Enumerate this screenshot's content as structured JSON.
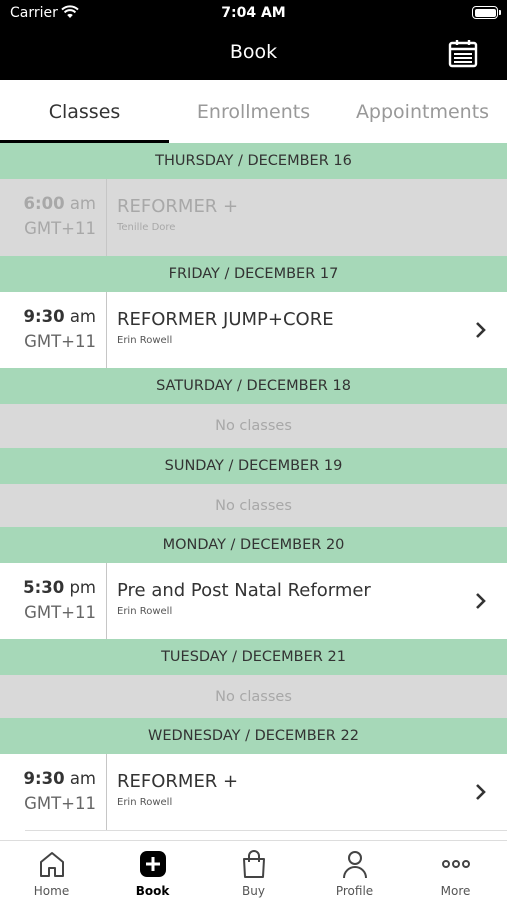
{
  "status_bar": {
    "carrier": "Carrier",
    "time": "7:04 AM"
  },
  "nav": {
    "title": "Book",
    "calendar_icon": "calendar-icon"
  },
  "tabs": [
    {
      "label": "Classes",
      "active": true
    },
    {
      "label": "Enrollments",
      "active": false
    },
    {
      "label": "Appointments",
      "active": false
    }
  ],
  "days": [
    {
      "header": "THURSDAY / DECEMBER 16",
      "class": {
        "time": "6:00",
        "ampm": "am",
        "tz": "GMT+11",
        "name": "REFORMER +",
        "teacher": "Tenille Dore",
        "disabled": true
      }
    },
    {
      "header": "FRIDAY / DECEMBER 17",
      "class": {
        "time": "9:30",
        "ampm": "am",
        "tz": "GMT+11",
        "name": "REFORMER JUMP+CORE",
        "teacher": "Erin Rowell",
        "disabled": false
      }
    },
    {
      "header": "SATURDAY / DECEMBER 18",
      "empty_text": "No classes"
    },
    {
      "header": "SUNDAY / DECEMBER 19",
      "empty_text": "No classes"
    },
    {
      "header": "MONDAY / DECEMBER 20",
      "class": {
        "time": "5:30",
        "ampm": "pm",
        "tz": "GMT+11",
        "name": "Pre and Post Natal Reformer",
        "teacher": "Erin Rowell",
        "disabled": false
      }
    },
    {
      "header": "TUESDAY / DECEMBER 21",
      "empty_text": "No classes"
    },
    {
      "header": "WEDNESDAY / DECEMBER 22",
      "class": {
        "time": "9:30",
        "ampm": "am",
        "tz": "GMT+11",
        "name": "REFORMER +",
        "teacher": "Erin Rowell",
        "disabled": false
      }
    }
  ],
  "tabbar": [
    {
      "label": "Home",
      "icon": "home-icon"
    },
    {
      "label": "Book",
      "icon": "plus-square-icon",
      "active": true
    },
    {
      "label": "Buy",
      "icon": "shopping-bag-icon"
    },
    {
      "label": "Profile",
      "icon": "person-icon"
    },
    {
      "label": "More",
      "icon": "more-dots-icon"
    }
  ],
  "colors": {
    "day_header": "#a6d8b8",
    "disabled_row": "#d9d9d9",
    "nav_bg": "#000000"
  }
}
